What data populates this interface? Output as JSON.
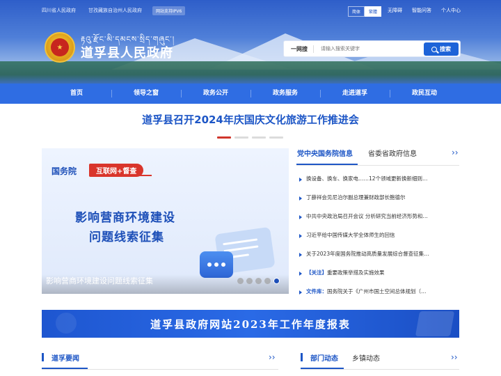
{
  "topbar": {
    "links": [
      "四川省人民政府",
      "甘孜藏族自治州人民政府"
    ],
    "ipv6": "网站支持IPV6",
    "lang": [
      "简体",
      "繁體"
    ],
    "right_links": [
      "无障碍",
      "智能问答",
      "个人中心"
    ]
  },
  "site": {
    "title_tibetan": "རྟའུ་རྫོང་མི་དམངས་སྲིད་གཞུང་།",
    "title": "道孚县人民政府"
  },
  "search": {
    "label": "一网搜",
    "placeholder": "请输入搜索关键字",
    "button": "搜索"
  },
  "nav": [
    "首页",
    "领导之窗",
    "政务公开",
    "政务服务",
    "走进道孚",
    "政民互动"
  ],
  "headline": "道孚县召开2024年庆国庆文化旅游工作推进会",
  "carousel": {
    "tag_org": "国务院",
    "tag_label": "互联网+督查",
    "line1": "影响营商环境建设",
    "line2": "问题线索征集",
    "caption": "影响营商环境建设问题线索征集",
    "dot_count": 5,
    "active_index": 4
  },
  "news": {
    "tabs": [
      "党中央国务院信息",
      "省委省政府信息"
    ],
    "items": [
      {
        "prefix": "",
        "text": "换设备、换车、换家电……12个领域更新换新细则…"
      },
      {
        "prefix": "",
        "text": "丁薛祥会见尼泊尔副总理兼财政部长鲍德尔"
      },
      {
        "prefix": "",
        "text": "中共中央政治局召开会议 分析研究当前经济形势和…"
      },
      {
        "prefix": "",
        "text": "习近平给中国传媒大学全体师生的回信"
      },
      {
        "prefix": "",
        "text": "关于2023年度国务院推动高质量发展综合督查征集…"
      },
      {
        "prefix": "【关注】",
        "text": "重要政策举措及实施效果"
      },
      {
        "prefix": "文件库：",
        "text": "国务院关于《广州市国土空间总体规划（…"
      }
    ]
  },
  "report": {
    "title": "道孚县政府网站2023年工作年度报表"
  },
  "sections": {
    "left_title": "道孚要闻",
    "right_tabs": [
      "部门动态",
      "乡镇动态"
    ]
  },
  "colors": {
    "primary": "#2f6de3",
    "headline": "#1d56c6",
    "accent_red": "#d0362c"
  }
}
